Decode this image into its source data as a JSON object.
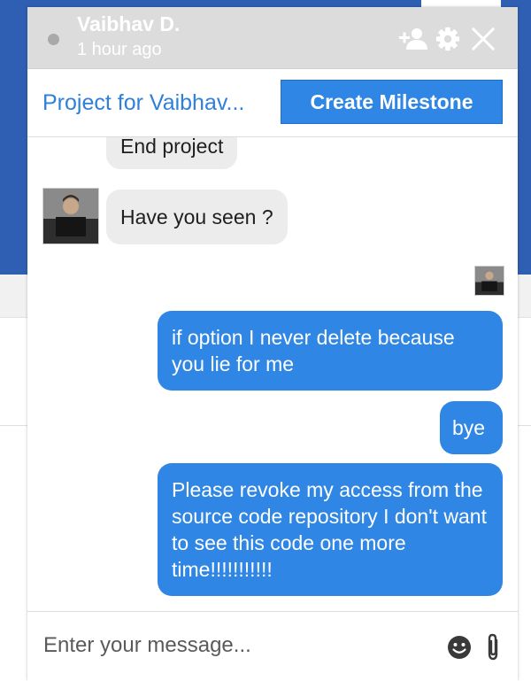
{
  "chat": {
    "user_name": "Vaibhav D.",
    "last_seen": "1 hour ago",
    "status_color": "#a9a9a9",
    "icons": [
      "add-user-icon",
      "gear-icon",
      "close-icon"
    ]
  },
  "project": {
    "title": "Project for Vaibhav...",
    "milestone_button": "Create Milestone"
  },
  "messages": [
    {
      "from": "them",
      "text": "End project"
    },
    {
      "from": "them",
      "text": "Have you seen ?"
    },
    {
      "from": "me",
      "text": "if option I never delete because you lie for me"
    },
    {
      "from": "me",
      "text": "bye"
    },
    {
      "from": "me",
      "text": "Please revoke my access from the source code repository I don't want to see this code one more time!!!!!!!!!!!"
    }
  ],
  "composer": {
    "placeholder": "Enter your message...",
    "icons": [
      "emoji-icon",
      "attach-icon"
    ]
  },
  "colors": {
    "accent": "#2f86e4",
    "link": "#2f80d8",
    "background": "#2f5fb3"
  }
}
